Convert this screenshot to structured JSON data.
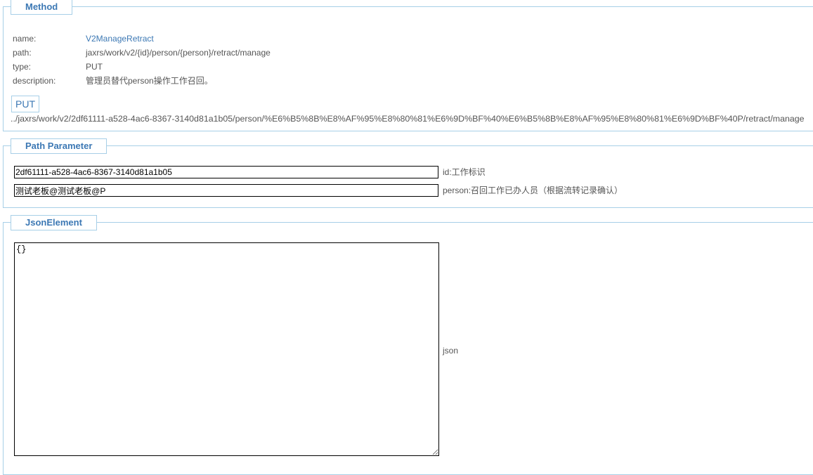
{
  "method_section": {
    "legend": "Method",
    "name_label": "name:",
    "name_value": "V2ManageRetract",
    "path_label": "path:",
    "path_value": "jaxrs/work/v2/{id}/person/{person}/retract/manage",
    "type_label": "type:",
    "type_value": "PUT",
    "description_label": "description:",
    "description_value": "管理员替代person操作工作召回。",
    "method_button": "PUT",
    "request_url": "../jaxrs/work/v2/2df61111-a528-4ac6-8367-3140d81a1b05/person/%E6%B5%8B%E8%AF%95%E8%80%81%E6%9D%BF%40%E6%B5%8B%E8%AF%95%E8%80%81%E6%9D%BF%40P/retract/manage"
  },
  "path_parameter_section": {
    "legend": "Path Parameter",
    "params": [
      {
        "value": "2df61111-a528-4ac6-8367-3140d81a1b05",
        "description": "id:工作标识"
      },
      {
        "value": "测试老板@测试老板@P",
        "description": "person:召回工作已办人员（根据流转记录确认）"
      }
    ]
  },
  "json_element_section": {
    "legend": "JsonElement",
    "body_value": "{}",
    "label": "json"
  },
  "colors": {
    "accent": "#3c78b4",
    "border": "#a7cfe7",
    "text": "#555555"
  }
}
